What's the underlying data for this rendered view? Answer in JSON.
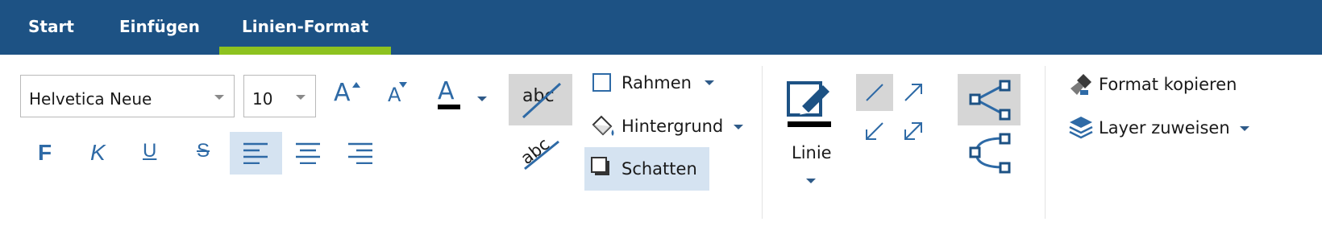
{
  "tabs": [
    {
      "label": "Start"
    },
    {
      "label": "Einfügen"
    },
    {
      "label": "Linien-Format",
      "active": true
    }
  ],
  "font": {
    "family": "Helvetica Neue",
    "size": "10"
  },
  "text_style": {
    "bold": "F",
    "italic": "K",
    "underline": "U",
    "strike": "S",
    "grow_letter": "A",
    "shrink_letter": "A",
    "color_letter": "A",
    "text_color": "#000000"
  },
  "line_text": {
    "label_1": "abc",
    "label_2": "abc"
  },
  "format": {
    "rahmen": "Rahmen",
    "hintergrund": "Hintergrund",
    "schatten": "Schatten"
  },
  "linie": {
    "label": "Linie",
    "color": "#000000"
  },
  "tools": {
    "format_kopieren": "Format kopieren",
    "layer_zuweisen": "Layer zuweisen"
  },
  "colors": {
    "tabbar": "#1d5284",
    "active_tab_underline": "#8dc21f",
    "icon_blue": "#2e6aa6",
    "selected_bg": "#d5e3f1"
  }
}
